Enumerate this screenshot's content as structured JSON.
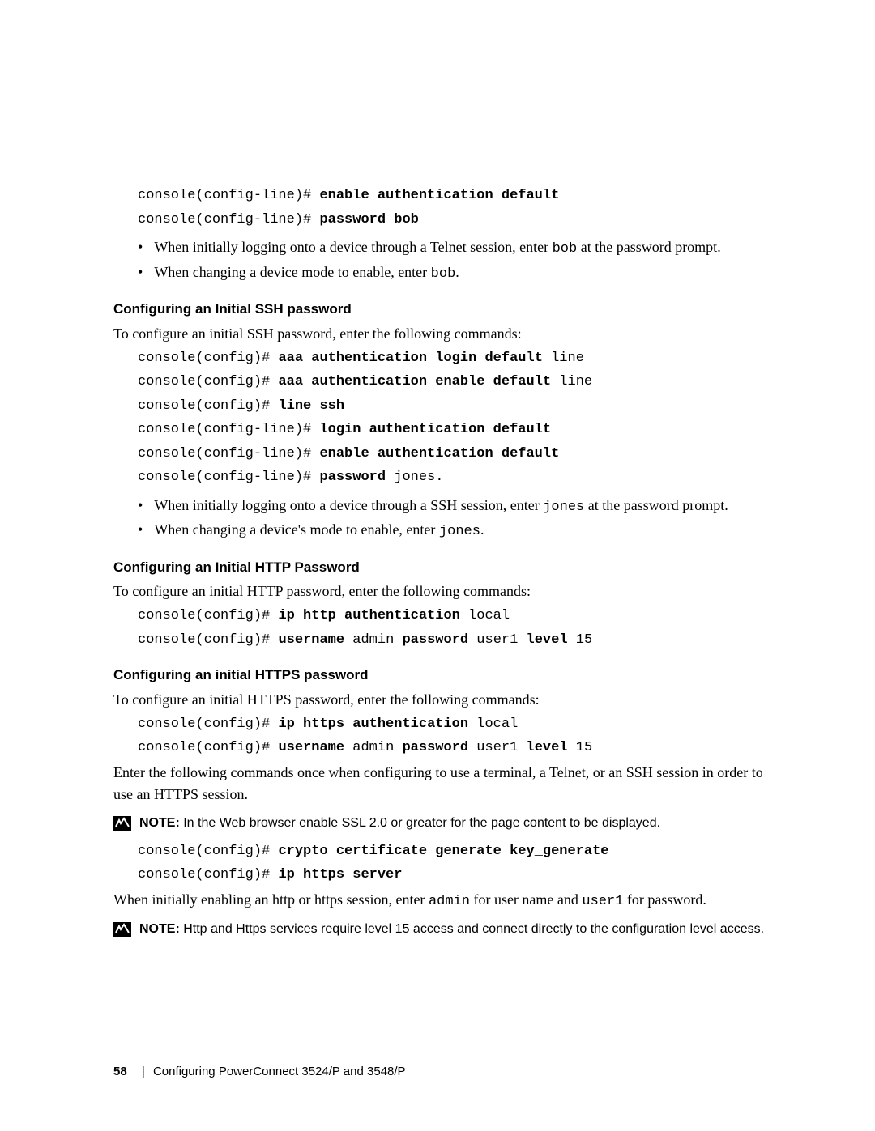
{
  "block1": {
    "l1_prompt": "console(config-line)# ",
    "l1_cmd": "enable authentication default",
    "l2_prompt": "console(config-line)# ",
    "l2_cmd": "password bob"
  },
  "bullets1": {
    "a_pre": "When initially logging onto a device through a Telnet session, enter ",
    "a_code": "bob",
    "a_post": " at the password prompt.",
    "b_pre": "When changing a device mode to enable, enter ",
    "b_code": "bob",
    "b_post": "."
  },
  "ssh": {
    "heading": "Configuring an Initial SSH password",
    "intro": "To configure an initial SSH password, enter the following commands:",
    "l1_prompt": "console(config)# ",
    "l1_cmd": "aaa authentication login default",
    "l1_tail": " line",
    "l2_prompt": "console(config)# ",
    "l2_cmd": "aaa authentication enable default",
    "l2_tail": " line",
    "l3_prompt": "console(config)# ",
    "l3_cmd": "line ssh",
    "l4_prompt": "console(config-line)# ",
    "l4_cmd": "login authentication default",
    "l5_prompt": "console(config-line)# ",
    "l5_cmd": "enable authentication default",
    "l6_prompt": "console(config-line)# ",
    "l6_cmd": "password",
    "l6_tail": " jones."
  },
  "bullets2": {
    "a_pre": "When initially logging onto a device through a SSH session, enter ",
    "a_code": "jones",
    "a_post": " at the password prompt.",
    "b_pre": "When changing a device's mode to enable, enter ",
    "b_code": "jones",
    "b_post": "."
  },
  "http": {
    "heading": "Configuring an Initial HTTP Password",
    "intro": "To configure an initial HTTP password, enter the following commands:",
    "l1_prompt": "console(config)# ",
    "l1_cmd": "ip http authentication",
    "l1_tail": " local",
    "l2_prompt": "console(config)# ",
    "l2_cmd1": "username",
    "l2_mid1": " admin ",
    "l2_cmd2": "password",
    "l2_mid2": " user1 ",
    "l2_cmd3": "level",
    "l2_tail": " 15"
  },
  "https": {
    "heading": "Configuring an initial HTTPS password",
    "intro": "To configure an initial HTTPS password, enter the following commands:",
    "l1_prompt": "console(config)# ",
    "l1_cmd": "ip https authentication",
    "l1_tail": " local",
    "l2_prompt": "console(config)# ",
    "l2_cmd1": "username",
    "l2_mid1": " admin ",
    "l2_cmd2": "password",
    "l2_mid2": " user1 ",
    "l2_cmd3": "level",
    "l2_tail": " 15",
    "para2": "Enter the following commands once when configuring to use a terminal, a Telnet, or an SSH session in order to use an HTTPS session.",
    "note1_label": "NOTE:",
    "note1_text": " In the Web browser enable SSL 2.0 or greater for the page content to be displayed.",
    "l3_prompt": "console(config)# ",
    "l3_cmd": "crypto certificate generate key_generate",
    "l4_prompt": "console(config)# ",
    "l4_cmd": "ip https server",
    "para3_pre": "When initially enabling an http or https session, enter ",
    "para3_code1": "admin",
    "para3_mid": " for user name and ",
    "para3_code2": "user1",
    "para3_post": " for password.",
    "note2_label": "NOTE:",
    "note2_text": " Http and Https services require level 15 access and connect directly to the configuration level access."
  },
  "footer": {
    "page": "58",
    "sep": "|",
    "title": "Configuring PowerConnect 3524/P and 3548/P"
  }
}
